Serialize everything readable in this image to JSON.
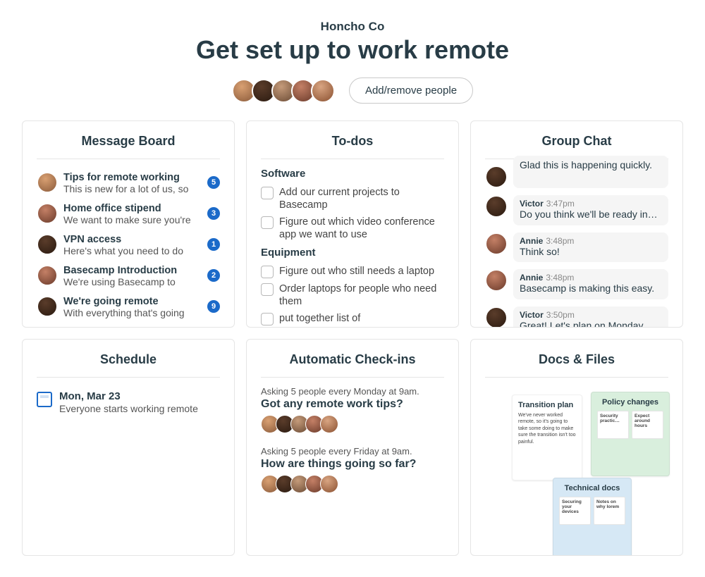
{
  "company": "Honcho Co",
  "title": "Get set up to work remote",
  "add_remove_label": "Add/remove people",
  "cards": {
    "message_board": {
      "title": "Message Board",
      "items": [
        {
          "title": "Tips for remote working",
          "preview": "This is new for a lot of us, so",
          "badge": "5"
        },
        {
          "title": "Home office stipend",
          "preview": "We want to make sure you're",
          "badge": "3"
        },
        {
          "title": "VPN access",
          "preview": "Here's what you need to do",
          "badge": "1"
        },
        {
          "title": "Basecamp Introduction",
          "preview": "We're using Basecamp to",
          "badge": "2"
        },
        {
          "title": "We're going remote",
          "preview": "With everything that's going",
          "badge": "9"
        }
      ]
    },
    "todos": {
      "title": "To-dos",
      "groups": [
        {
          "name": "Software",
          "items": [
            "Add our current projects to Basecamp",
            "Figure out which video conference app we want to use"
          ]
        },
        {
          "name": "Equipment",
          "items": [
            "Figure out who still needs a laptop",
            "Order laptops for people who need them",
            "put together list of"
          ]
        }
      ]
    },
    "chat": {
      "title": "Group Chat",
      "messages": [
        {
          "name": "",
          "time": "",
          "text": "Glad this is happening quickly.",
          "partial": true
        },
        {
          "name": "Victor",
          "time": "3:47pm",
          "text": "Do you think we'll be ready in…"
        },
        {
          "name": "Annie",
          "time": "3:48pm",
          "text": "Think so!"
        },
        {
          "name": "Annie",
          "time": "3:48pm",
          "text": "Basecamp is making this easy."
        },
        {
          "name": "Victor",
          "time": "3:50pm",
          "text": "Great! Let's plan on Monday…"
        }
      ]
    },
    "schedule": {
      "title": "Schedule",
      "item": {
        "date": "Mon, Mar 23",
        "desc": "Everyone starts working remote"
      }
    },
    "checkins": {
      "title": "Automatic Check-ins",
      "items": [
        {
          "freq": "Asking 5 people every Monday at 9am.",
          "question": "Got any remote work tips?"
        },
        {
          "freq": "Asking 5 people every Friday at 9am.",
          "question": "How are things going so far?"
        }
      ]
    },
    "docs": {
      "title": "Docs & Files",
      "white": {
        "title": "Transition plan",
        "body": "We've never worked remote, so it's going to take some doing to make sure the transition isn't too painful."
      },
      "green": {
        "title": "Policy changes",
        "chips": [
          "Security practic…",
          "Expect around hours"
        ]
      },
      "blue": {
        "title": "Technical docs",
        "chips": [
          "Securing your devices",
          "Notes on why lorem"
        ]
      }
    }
  }
}
